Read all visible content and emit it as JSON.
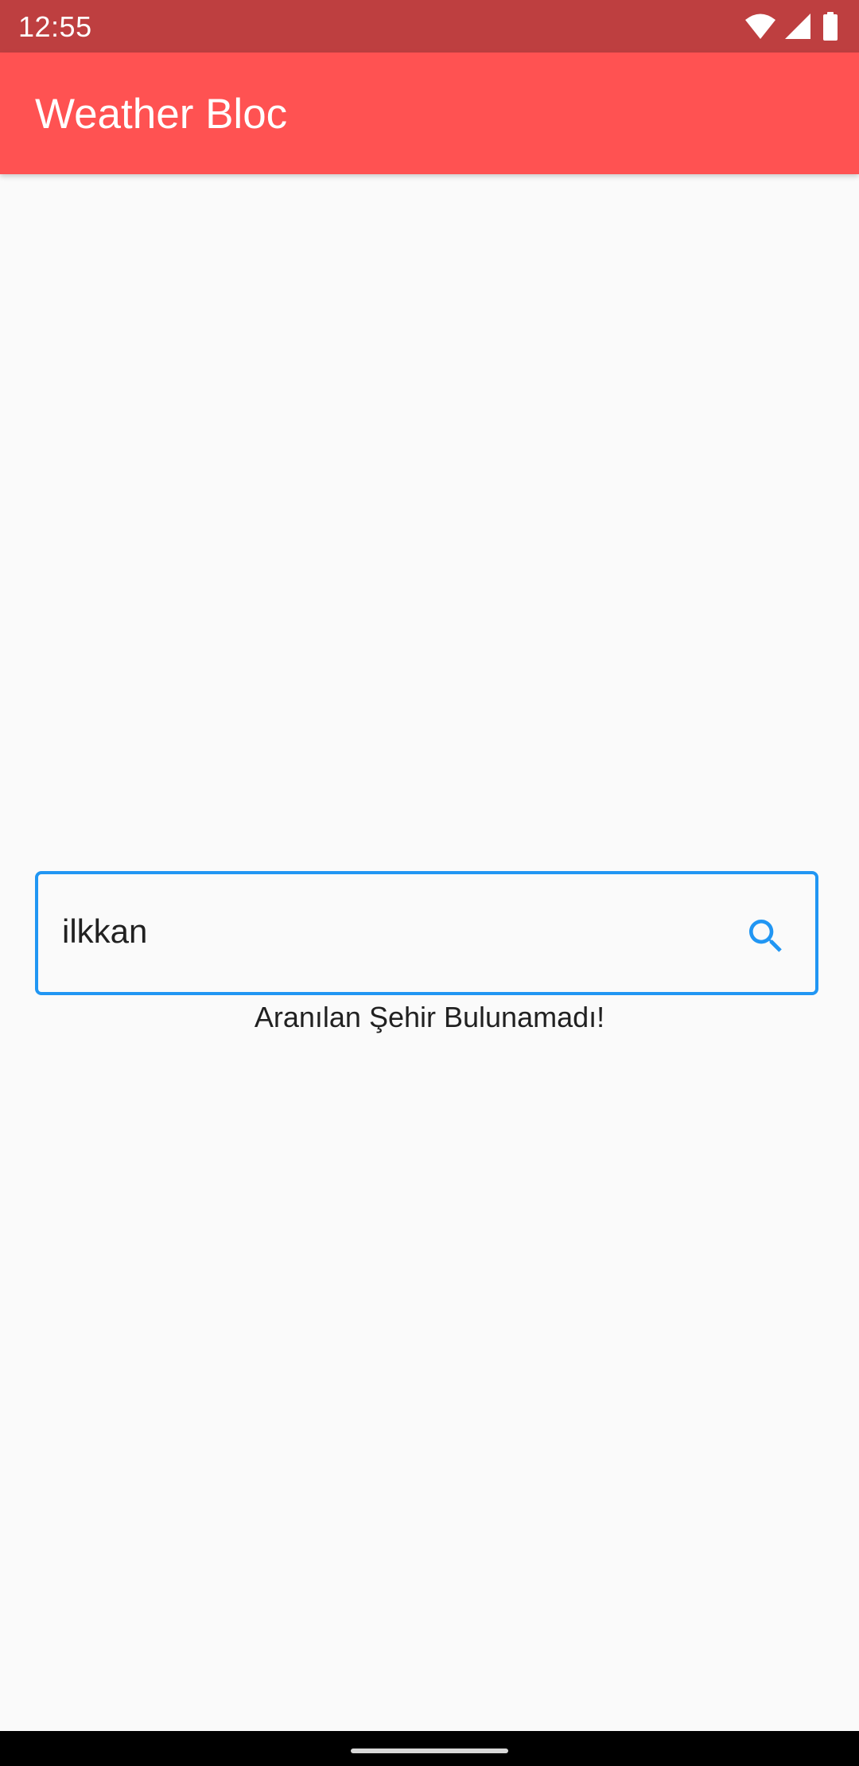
{
  "status_bar": {
    "time": "12:55",
    "icons": [
      "wifi-icon",
      "signal-icon",
      "battery-icon"
    ],
    "color": "#BE3F40"
  },
  "app_bar": {
    "title": "Weather Bloc",
    "color": "#FF5252"
  },
  "search": {
    "value": "ilkkan",
    "icon": "search-icon",
    "accent": "#2196F3"
  },
  "message": {
    "text": "Aranılan Şehir Bulunamadı!"
  }
}
